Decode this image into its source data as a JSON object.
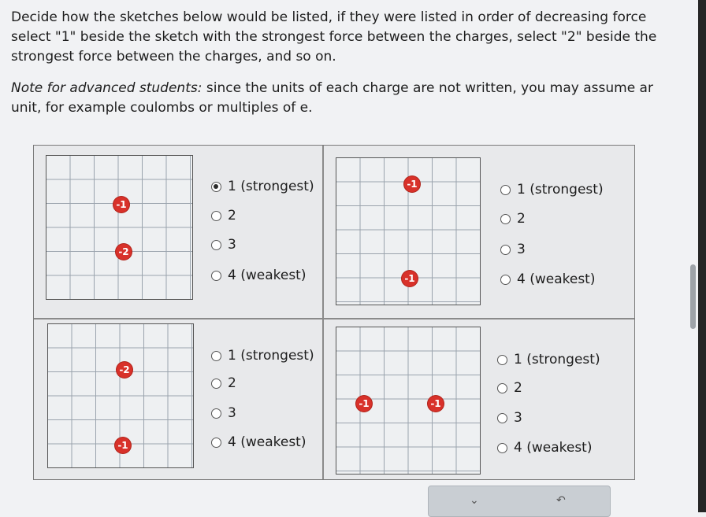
{
  "instructions": {
    "line1": "Decide how the sketches below would be listed, if they were listed in order of decreasing force",
    "line2": "select \"1\" beside the sketch with the strongest force between the charges, select \"2\" beside the",
    "line3": "strongest force between the charges, and so on.",
    "note_label": "Note for advanced students:",
    "note_rest1": " since the units of each charge are not written, you may assume ar",
    "note_line2": "unit, for example coulombs or multiples of e."
  },
  "options": [
    "1 (strongest)",
    "2",
    "3",
    "4 (weakest)"
  ],
  "sketches": [
    {
      "charges": [
        "-1",
        "-2"
      ],
      "selected": "1 (strongest)"
    },
    {
      "charges": [
        "-1",
        "-1"
      ],
      "selected": null
    },
    {
      "charges": [
        "-2",
        "-1"
      ],
      "selected": null
    },
    {
      "charges": [
        "-1",
        "-1"
      ],
      "selected": null
    }
  ],
  "colors": {
    "charge": "#d8312a",
    "panel_bg": "#e8e9eb",
    "grid_line": "#9aa3ad"
  },
  "icons": {
    "nav_left": "chevron-down-icon",
    "nav_right": "back-arrow-icon"
  }
}
